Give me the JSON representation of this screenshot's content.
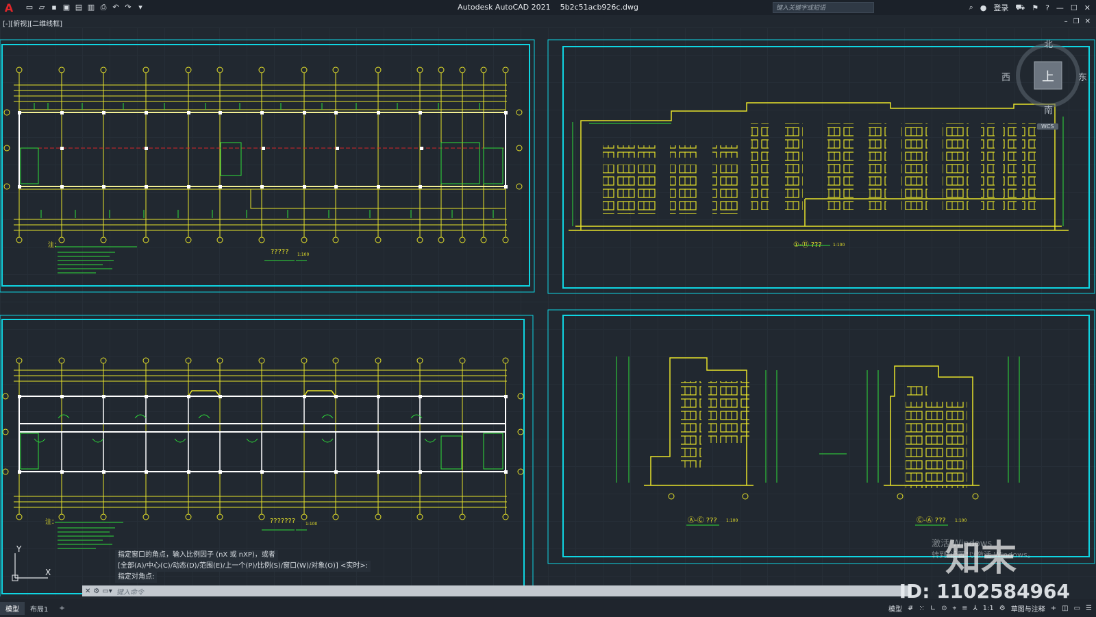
{
  "titlebar": {
    "app_title": "Autodesk AutoCAD 2021",
    "file_name": "5b2c51acb926c.dwg",
    "search_placeholder": "键入关键字或短语",
    "login": "登录"
  },
  "viewport": {
    "view_label": "[-][俯视][二维线框]"
  },
  "viewcube": {
    "north": "北",
    "south": "南",
    "east": "东",
    "west": "西",
    "face": "上",
    "wcs": "WCS"
  },
  "drawings": {
    "plan1_title": "?????",
    "plan1_scale": "1:100",
    "plan2_title": "???????",
    "plan2_scale": "1:100",
    "elev1_title": "①-⑪ ???",
    "elev1_scale": "1:100",
    "elev2_title": "Ⓐ-Ⓒ ???",
    "elev2_scale": "1:100",
    "elev3_title": "Ⓒ-Ⓐ ???",
    "elev3_scale": "1:100",
    "notes_label": "注："
  },
  "command": {
    "history": [
      "指定窗口的角点，输入比例因子 (nX 或 nXP)，或者",
      "[全部(A)/中心(C)/动态(D)/范围(E)/上一个(P)/比例(S)/窗口(W)/对象(O)] <实时>:",
      "指定对角点:"
    ],
    "placeholder": "键入命令"
  },
  "layout_tabs": [
    "模型",
    "布局1"
  ],
  "status": {
    "model": "模型",
    "scale": "1:1",
    "workspace": "草图与注释"
  },
  "watermark": {
    "brand": "知末",
    "id_text": "ID: 1102584964",
    "activate_line1": "激活 Windows",
    "activate_line2": "转到\"设置\"以激活 Windows。"
  },
  "colors": {
    "cad_yellow": "#e8e32a",
    "cad_cyan": "#0fd6e3",
    "cad_green": "#2ee03a",
    "cad_red": "#d9262a",
    "background": "#212830"
  }
}
